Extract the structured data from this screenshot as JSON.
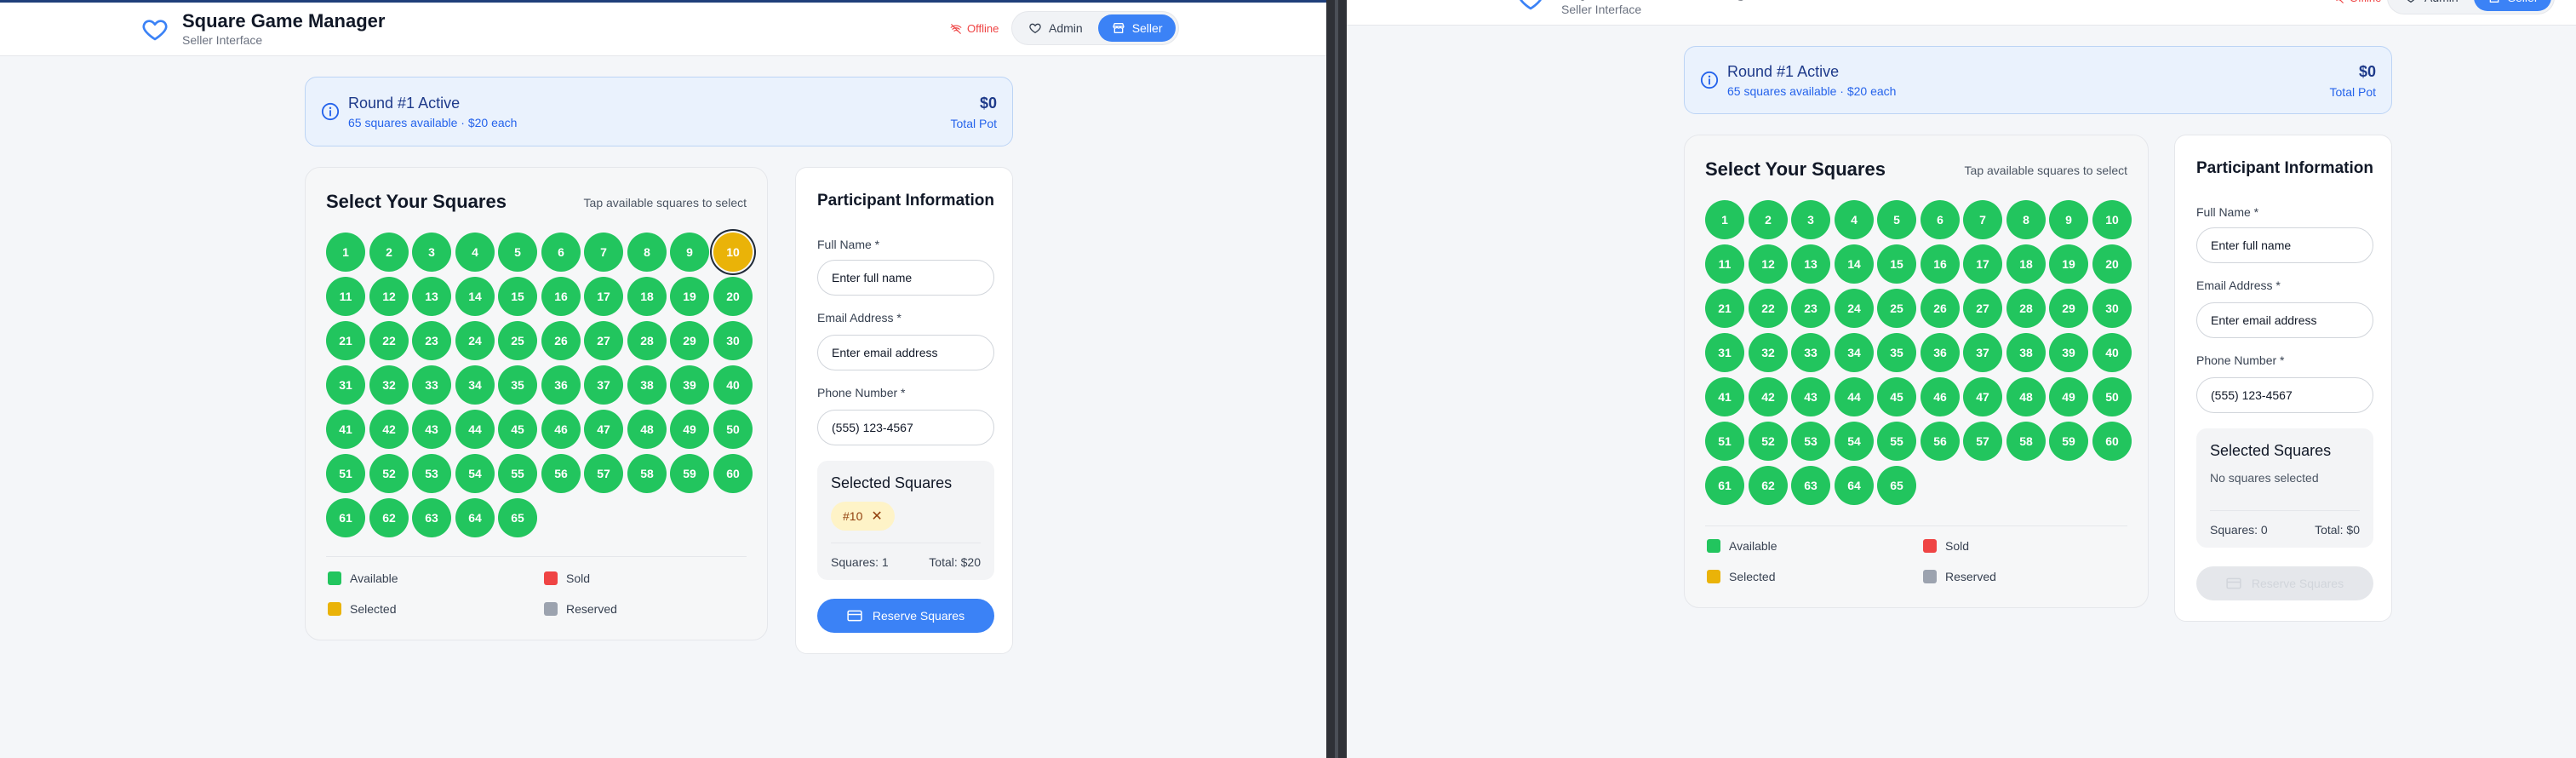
{
  "app": {
    "title": "Square Game Manager",
    "subtitle": "Seller Interface",
    "status": "Offline",
    "roles": [
      "Admin",
      "Seller"
    ]
  },
  "round": {
    "title": "Round #1 Active",
    "subtitle": "65 squares available · $20 each",
    "pot": "$0",
    "pot_label": "Total Pot"
  },
  "squares": {
    "title": "Select Your Squares",
    "hint": "Tap available squares to select",
    "numbers": [
      "1",
      "2",
      "3",
      "4",
      "5",
      "6",
      "7",
      "8",
      "9",
      "10",
      "11",
      "12",
      "13",
      "14",
      "15",
      "16",
      "17",
      "18",
      "19",
      "20",
      "21",
      "22",
      "23",
      "24",
      "25",
      "26",
      "27",
      "28",
      "29",
      "30",
      "31",
      "32",
      "33",
      "34",
      "35",
      "36",
      "37",
      "38",
      "39",
      "40",
      "41",
      "42",
      "43",
      "44",
      "45",
      "46",
      "47",
      "48",
      "49",
      "50",
      "51",
      "52",
      "53",
      "54",
      "55",
      "56",
      "57",
      "58",
      "59",
      "60",
      "61",
      "62",
      "63",
      "64",
      "65"
    ]
  },
  "legend": {
    "available": "Available",
    "sold": "Sold",
    "selected": "Selected",
    "reserved": "Reserved"
  },
  "colors": {
    "available": "#22c55e",
    "sold": "#ef4444",
    "selected": "#eab308",
    "reserved": "#9ca3af",
    "accent": "#3b82f6"
  },
  "form": {
    "title": "Participant Information",
    "name_label": "Full Name *",
    "name_placeholder": "Enter full name",
    "email_label": "Email Address *",
    "email_placeholder": "Enter email address",
    "phone_label": "Phone Number *",
    "phone_placeholder": "(555) 123-4567"
  },
  "left": {
    "selected_squares": [
      "10"
    ],
    "selection": {
      "title": "Selected Squares",
      "chip": "#10",
      "count": "Squares: 1",
      "total": "Total: $20"
    },
    "reserve_label": "Reserve Squares"
  },
  "right": {
    "selected_squares": [],
    "selection": {
      "title": "Selected Squares",
      "empty": "No squares selected",
      "count": "Squares: 0",
      "total": "Total: $0"
    },
    "reserve_label": "Reserve Squares"
  }
}
